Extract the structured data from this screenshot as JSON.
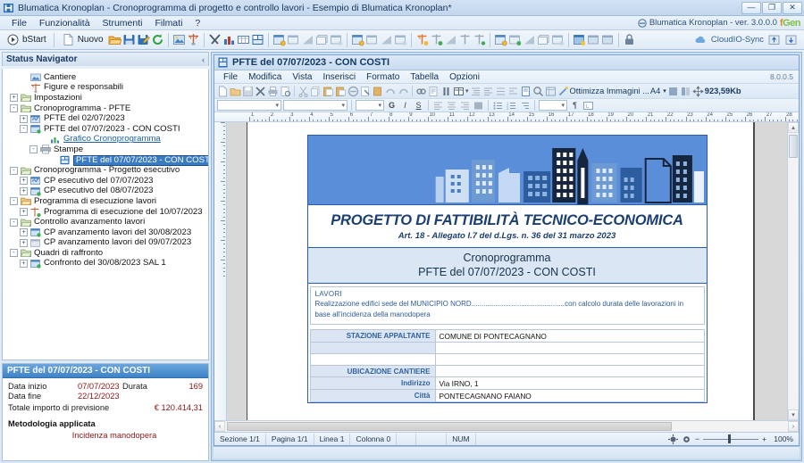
{
  "window": {
    "title": "Blumatica Kronoplan - Cronoprogramma di progetto e controllo lavori - Esempio di Blumatica Kronoplan*",
    "icon": "app-icon",
    "minimize": "—",
    "maximize": "❐",
    "close": "✕"
  },
  "menubar": {
    "items": [
      "File",
      "Funzionalità",
      "Strumenti",
      "Filmati",
      "?"
    ],
    "version_text": "Blumatica Kronoplan - ver. 3.0.0.0",
    "logo_prefix": "f",
    "logo_suffix": "Gen"
  },
  "toolbar": {
    "start_label": "bStart",
    "new_label": "Nuovo",
    "cloud_label": "CloudIO-Sync",
    "icons": [
      "open-folder-icon",
      "save-icon",
      "save-as-icon",
      "refresh-icon",
      "cantiere-icon",
      "figure-icon",
      "tools-icon",
      "chart-bar-icon",
      "table-icon",
      "report-icon",
      "cp-new-icon",
      "cp-copy-icon",
      "cp-chart-icon",
      "cp-dup-icon",
      "cp-report-icon",
      "pe-new-icon",
      "pe-copy-icon",
      "pe-chart-icon",
      "pe-report-icon",
      "av-new-icon",
      "av-add-icon",
      "av-chart-icon",
      "av-up-icon",
      "av-down-icon",
      "qr-new-icon",
      "qr-add-icon",
      "qr-chart-icon",
      "qr-copy-icon",
      "qr-report-icon",
      "ex-new-icon",
      "ex-copy-icon",
      "ex-report-icon",
      "lock-icon"
    ],
    "cloud_up_icon": "cloud-upload-icon",
    "cloud_down_icon": "cloud-download-icon"
  },
  "status_navigator": {
    "title": "Status Navigator",
    "collapse_icon": "chevron-left-icon",
    "tree": [
      {
        "label": "Cantiere",
        "indent": 1,
        "expander": "none",
        "icon": "cantiere-icon"
      },
      {
        "label": "Figure e responsabili",
        "indent": 1,
        "expander": "none",
        "icon": "figure-icon"
      },
      {
        "label": "Impostazioni",
        "indent": 0,
        "expander": "+",
        "icon": "folder-icon"
      },
      {
        "label": "Cronoprogramma - PFTE",
        "indent": 0,
        "expander": "-",
        "icon": "folder-icon"
      },
      {
        "label": "PFTE  del 02/07/2023",
        "indent": 1,
        "expander": "+",
        "icon": "doc-blue-icon"
      },
      {
        "label": "PFTE  del 07/07/2023 - CON COSTI",
        "indent": 1,
        "expander": "-",
        "icon": "doc-green-icon"
      },
      {
        "label": "Grafico Cronoprogramma",
        "indent": 3,
        "expander": "none",
        "icon": "chart-icon",
        "link": true
      },
      {
        "label": "Stampe",
        "indent": 2,
        "expander": "-",
        "icon": "printer-icon"
      },
      {
        "label": "PFTE  del 07/07/2023 - CON COSTI",
        "indent": 4,
        "expander": "none",
        "icon": "print-doc-icon",
        "selected": true
      },
      {
        "label": "Cronoprogramma - Progetto esecutivo",
        "indent": 0,
        "expander": "-",
        "icon": "folder-icon"
      },
      {
        "label": "CP esecutivo del 07/07/2023",
        "indent": 1,
        "expander": "+",
        "icon": "doc-blue-icon"
      },
      {
        "label": "CP esecutivo del 08/07/2023",
        "indent": 1,
        "expander": "+",
        "icon": "doc-green-icon"
      },
      {
        "label": "Programma di esecuzione lavori",
        "indent": 0,
        "expander": "-",
        "icon": "folder-orange-icon"
      },
      {
        "label": "Programma di esecuzione del 10/07/2023",
        "indent": 1,
        "expander": "+",
        "icon": "figure-green-icon"
      },
      {
        "label": "Controllo avanzamento lavori",
        "indent": 0,
        "expander": "-",
        "icon": "folder-icon"
      },
      {
        "label": "CP avanzamento lavori del 30/08/2023",
        "indent": 1,
        "expander": "+",
        "icon": "doc-green-icon"
      },
      {
        "label": "CP avanzamento lavori del 09/07/2023",
        "indent": 1,
        "expander": "+",
        "icon": "doc-grey-icon"
      },
      {
        "label": "Quadri di raffronto",
        "indent": 0,
        "expander": "-",
        "icon": "folder-icon"
      },
      {
        "label": "Confronto del 30/08/2023 SAL 1",
        "indent": 1,
        "expander": "+",
        "icon": "doc-green-icon"
      }
    ]
  },
  "info_panel": {
    "header": "PFTE  del 07/07/2023 - CON COSTI",
    "start_label": "Data inizio",
    "start_value": "07/07/2023",
    "end_label": "Data fine",
    "end_value": "22/12/2023",
    "duration_label": "Durata",
    "duration_value": "169",
    "total_label": "Totale importo di previsione",
    "total_value": "€ 120.414,31",
    "method_label": "Metodologia applicata",
    "method_value": "Incidenza manodopera"
  },
  "document_window": {
    "title": "PFTE  del 07/07/2023 - CON COSTI",
    "icon": "report-doc-icon",
    "menu": [
      "File",
      "Modifica",
      "Vista",
      "Inserisci",
      "Formato",
      "Tabella",
      "Opzioni"
    ],
    "version": "8.0.0.5",
    "optimize_label": "Ottimizza Immagini ...",
    "paper_size": "A4",
    "file_size": "923,59Kb",
    "format_buttons": [
      "G",
      "I",
      "S"
    ],
    "toolbar_icons": [
      "new-doc-icon",
      "open-doc-icon",
      "save-doc-icon",
      "close-doc-icon",
      "print-icon",
      "print-preview-icon",
      "cut-icon",
      "copy-icon",
      "paste-icon",
      "paste-special-icon",
      "delete-icon",
      "find-icon",
      "replace-icon",
      "undo-icon",
      "redo-icon",
      "link-icon",
      "page-setup-icon",
      "pause-icon",
      "columns-icon",
      "indent-icon",
      "align-icon",
      "spacing-icon",
      "para-icon",
      "page-icon",
      "zoom-icon",
      "fields-icon",
      "wand-icon"
    ],
    "list_icons": [
      "bullet-list-icon",
      "number-list-icon",
      "multi-list-icon",
      "pilcrow-icon",
      "textbox-icon"
    ]
  },
  "report": {
    "banner_icon": "city-skyline-graphic",
    "title": "PROGETTO DI FATTIBILITÀ TECNICO-ECONOMICA",
    "subtitle": "Art. 18 - Allegato I.7 del d.Lgs. n. 36 del 31 marzo 2023",
    "section_line1": "Cronoprogramma",
    "section_line2": "PFTE  del 07/07/2023 - CON COSTI",
    "works_header": "LAVORI",
    "works_body": "Realizzazione edifici sede del MUNICIPIO NORD...............................................con calcolo durata delle lavorazioni in base all'incidenza della manodopera",
    "rows": [
      {
        "label": "STAZIONE APPALTANTE",
        "value": "COMUNE DI PONTECAGNANO",
        "style": "header"
      },
      {
        "label": "",
        "value": "",
        "style": "header"
      },
      {
        "label": "",
        "value": "",
        "style": "white"
      },
      {
        "label": "UBICAZIONE CANTIERE",
        "value": "",
        "style": "header"
      },
      {
        "label": "Indirizzo",
        "value": "Via IRNO, 1",
        "style": "header"
      },
      {
        "label": "Città",
        "value": "PONTECAGNANO FAIANO",
        "style": "header"
      }
    ]
  },
  "doc_statusbar": {
    "section": "Sezione 1/1",
    "page": "Pagina 1/1",
    "line": "Linea 1",
    "column": "Colonna 0",
    "blank1": "",
    "blank2": "",
    "num": "NUM",
    "zoom_out": "−",
    "zoom_in": "+",
    "zoom_value": "100%",
    "fit_page_icon": "fit-page-icon",
    "fit_width_icon": "fit-width-icon"
  },
  "colors": {
    "accent": "#3a7cc4",
    "banner": "#5a8ed8",
    "title_blue": "#1b3f73",
    "value_red": "#8a1515",
    "section_bg": "#dbe6f5"
  },
  "ruler": {
    "h_labels": [
      "1",
      "2",
      "3",
      "4",
      "5",
      "6",
      "7",
      "8",
      "9",
      "10",
      "11",
      "12",
      "13",
      "14",
      "15",
      "16",
      "17",
      "18",
      "19",
      "20",
      "21",
      "22",
      "23",
      "24",
      "25",
      "26",
      "27",
      "28"
    ]
  }
}
